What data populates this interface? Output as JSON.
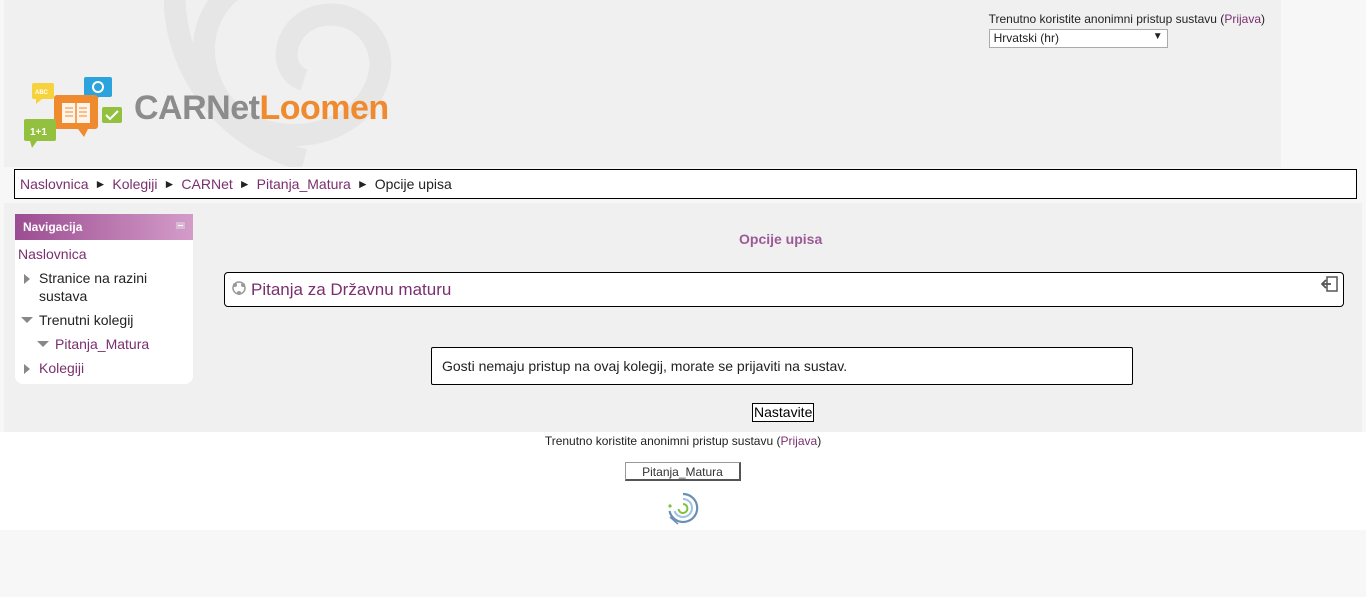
{
  "header": {
    "login_info": "Trenutno koristite anonimni pristup sustavu",
    "login_link": "Prijava",
    "language": "Hrvatski (hr)",
    "logo_text_part1": "CARNet",
    "logo_text_part2": "Loomen",
    "logo_badge_abc": "ABC",
    "logo_badge_math": "1+1"
  },
  "breadcrumb": {
    "items": [
      "Naslovnica",
      "Kolegiji",
      "CARNet",
      "Pitanja_Matura"
    ],
    "current": "Opcije upisa",
    "separator": "►"
  },
  "navigation": {
    "title": "Navigacija",
    "home": "Naslovnica",
    "items": [
      {
        "label": "Stranice na razini sustava",
        "state": "collapsed"
      },
      {
        "label": "Trenutni kolegij",
        "state": "expanded"
      },
      {
        "label": "Pitanja_Matura",
        "state": "expanded"
      },
      {
        "label": "Kolegiji",
        "state": "collapsed"
      }
    ]
  },
  "main": {
    "page_title": "Opcije upisa",
    "course_name": "Pitanja za Državnu maturu",
    "notice": "Gosti nemaju pristup na ovaj kolegij, morate se prijaviti na sustav.",
    "continue_button": "Nastavite"
  },
  "footer": {
    "login_info": "Trenutno koristite anonimni pristup sustavu",
    "login_link": "Prijava",
    "home_button": "Pitanja_Matura"
  },
  "colors": {
    "accent": "#7a2f6e",
    "nav_header": "#9b4d91",
    "logo_grey": "#8c8c8c",
    "logo_orange": "#f08a2e"
  },
  "icons": {
    "course": "course-icon",
    "enrol": "enrol-self-icon",
    "collapse": "block-collapse-icon",
    "footer": "moodle-logo-icon"
  }
}
